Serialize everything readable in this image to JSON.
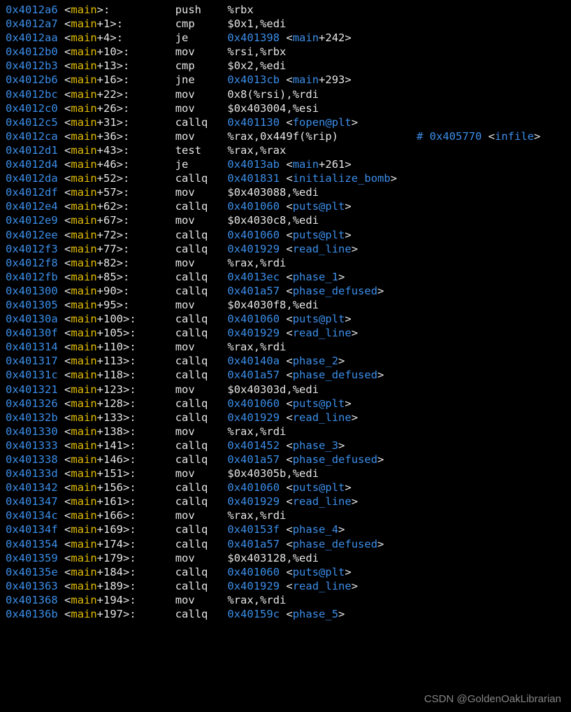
{
  "watermark": "CSDN @GoldenOakLibrarian",
  "mnem_col": 26,
  "ops_col": 34,
  "lines": [
    {
      "addr": "0x4012a6",
      "sym": "main",
      "off": "",
      "mnem": "push",
      "ops": "%rbx"
    },
    {
      "addr": "0x4012a7",
      "sym": "main",
      "off": "1",
      "mnem": "cmp",
      "ops": "$0x1,%edi"
    },
    {
      "addr": "0x4012aa",
      "sym": "main",
      "off": "4",
      "mnem": "je",
      "target_addr": "0x401398",
      "target_sym": "main",
      "target_off": "242"
    },
    {
      "addr": "0x4012b0",
      "sym": "main",
      "off": "10",
      "mnem": "mov",
      "ops": "%rsi,%rbx"
    },
    {
      "addr": "0x4012b3",
      "sym": "main",
      "off": "13",
      "mnem": "cmp",
      "ops": "$0x2,%edi"
    },
    {
      "addr": "0x4012b6",
      "sym": "main",
      "off": "16",
      "mnem": "jne",
      "target_addr": "0x4013cb",
      "target_sym": "main",
      "target_off": "293"
    },
    {
      "addr": "0x4012bc",
      "sym": "main",
      "off": "22",
      "mnem": "mov",
      "ops": "0x8(%rsi),%rdi"
    },
    {
      "addr": "0x4012c0",
      "sym": "main",
      "off": "26",
      "mnem": "mov",
      "ops": "$0x403004,%esi"
    },
    {
      "addr": "0x4012c5",
      "sym": "main",
      "off": "31",
      "mnem": "callq",
      "target_addr": "0x401130",
      "target_sym": "fopen@plt"
    },
    {
      "addr": "0x4012ca",
      "sym": "main",
      "off": "36",
      "mnem": "mov",
      "ops": "%rax,0x449f(%rip)",
      "comment_addr": "0x405770",
      "comment_sym": "infile"
    },
    {
      "addr": "0x4012d1",
      "sym": "main",
      "off": "43",
      "mnem": "test",
      "ops": "%rax,%rax"
    },
    {
      "addr": "0x4012d4",
      "sym": "main",
      "off": "46",
      "mnem": "je",
      "target_addr": "0x4013ab",
      "target_sym": "main",
      "target_off": "261"
    },
    {
      "addr": "0x4012da",
      "sym": "main",
      "off": "52",
      "mnem": "callq",
      "target_addr": "0x401831",
      "target_sym": "initialize_bomb"
    },
    {
      "addr": "0x4012df",
      "sym": "main",
      "off": "57",
      "mnem": "mov",
      "ops": "$0x403088,%edi"
    },
    {
      "addr": "0x4012e4",
      "sym": "main",
      "off": "62",
      "mnem": "callq",
      "target_addr": "0x401060",
      "target_sym": "puts@plt"
    },
    {
      "addr": "0x4012e9",
      "sym": "main",
      "off": "67",
      "mnem": "mov",
      "ops": "$0x4030c8,%edi"
    },
    {
      "addr": "0x4012ee",
      "sym": "main",
      "off": "72",
      "mnem": "callq",
      "target_addr": "0x401060",
      "target_sym": "puts@plt"
    },
    {
      "addr": "0x4012f3",
      "sym": "main",
      "off": "77",
      "mnem": "callq",
      "target_addr": "0x401929",
      "target_sym": "read_line"
    },
    {
      "addr": "0x4012f8",
      "sym": "main",
      "off": "82",
      "mnem": "mov",
      "ops": "%rax,%rdi"
    },
    {
      "addr": "0x4012fb",
      "sym": "main",
      "off": "85",
      "mnem": "callq",
      "target_addr": "0x4013ec",
      "target_sym": "phase_1"
    },
    {
      "addr": "0x401300",
      "sym": "main",
      "off": "90",
      "mnem": "callq",
      "target_addr": "0x401a57",
      "target_sym": "phase_defused"
    },
    {
      "addr": "0x401305",
      "sym": "main",
      "off": "95",
      "mnem": "mov",
      "ops": "$0x4030f8,%edi"
    },
    {
      "addr": "0x40130a",
      "sym": "main",
      "off": "100",
      "mnem": "callq",
      "target_addr": "0x401060",
      "target_sym": "puts@plt"
    },
    {
      "addr": "0x40130f",
      "sym": "main",
      "off": "105",
      "mnem": "callq",
      "target_addr": "0x401929",
      "target_sym": "read_line"
    },
    {
      "addr": "0x401314",
      "sym": "main",
      "off": "110",
      "mnem": "mov",
      "ops": "%rax,%rdi"
    },
    {
      "addr": "0x401317",
      "sym": "main",
      "off": "113",
      "mnem": "callq",
      "target_addr": "0x40140a",
      "target_sym": "phase_2"
    },
    {
      "addr": "0x40131c",
      "sym": "main",
      "off": "118",
      "mnem": "callq",
      "target_addr": "0x401a57",
      "target_sym": "phase_defused"
    },
    {
      "addr": "0x401321",
      "sym": "main",
      "off": "123",
      "mnem": "mov",
      "ops": "$0x40303d,%edi"
    },
    {
      "addr": "0x401326",
      "sym": "main",
      "off": "128",
      "mnem": "callq",
      "target_addr": "0x401060",
      "target_sym": "puts@plt"
    },
    {
      "addr": "0x40132b",
      "sym": "main",
      "off": "133",
      "mnem": "callq",
      "target_addr": "0x401929",
      "target_sym": "read_line"
    },
    {
      "addr": "0x401330",
      "sym": "main",
      "off": "138",
      "mnem": "mov",
      "ops": "%rax,%rdi"
    },
    {
      "addr": "0x401333",
      "sym": "main",
      "off": "141",
      "mnem": "callq",
      "target_addr": "0x401452",
      "target_sym": "phase_3"
    },
    {
      "addr": "0x401338",
      "sym": "main",
      "off": "146",
      "mnem": "callq",
      "target_addr": "0x401a57",
      "target_sym": "phase_defused"
    },
    {
      "addr": "0x40133d",
      "sym": "main",
      "off": "151",
      "mnem": "mov",
      "ops": "$0x40305b,%edi"
    },
    {
      "addr": "0x401342",
      "sym": "main",
      "off": "156",
      "mnem": "callq",
      "target_addr": "0x401060",
      "target_sym": "puts@plt"
    },
    {
      "addr": "0x401347",
      "sym": "main",
      "off": "161",
      "mnem": "callq",
      "target_addr": "0x401929",
      "target_sym": "read_line"
    },
    {
      "addr": "0x40134c",
      "sym": "main",
      "off": "166",
      "mnem": "mov",
      "ops": "%rax,%rdi"
    },
    {
      "addr": "0x40134f",
      "sym": "main",
      "off": "169",
      "mnem": "callq",
      "target_addr": "0x40153f",
      "target_sym": "phase_4"
    },
    {
      "addr": "0x401354",
      "sym": "main",
      "off": "174",
      "mnem": "callq",
      "target_addr": "0x401a57",
      "target_sym": "phase_defused"
    },
    {
      "addr": "0x401359",
      "sym": "main",
      "off": "179",
      "mnem": "mov",
      "ops": "$0x403128,%edi"
    },
    {
      "addr": "0x40135e",
      "sym": "main",
      "off": "184",
      "mnem": "callq",
      "target_addr": "0x401060",
      "target_sym": "puts@plt"
    },
    {
      "addr": "0x401363",
      "sym": "main",
      "off": "189",
      "mnem": "callq",
      "target_addr": "0x401929",
      "target_sym": "read_line"
    },
    {
      "addr": "0x401368",
      "sym": "main",
      "off": "194",
      "mnem": "mov",
      "ops": "%rax,%rdi"
    },
    {
      "addr": "0x40136b",
      "sym": "main",
      "off": "197",
      "mnem": "callq",
      "target_addr": "0x40159c",
      "target_sym": "phase_5"
    }
  ]
}
